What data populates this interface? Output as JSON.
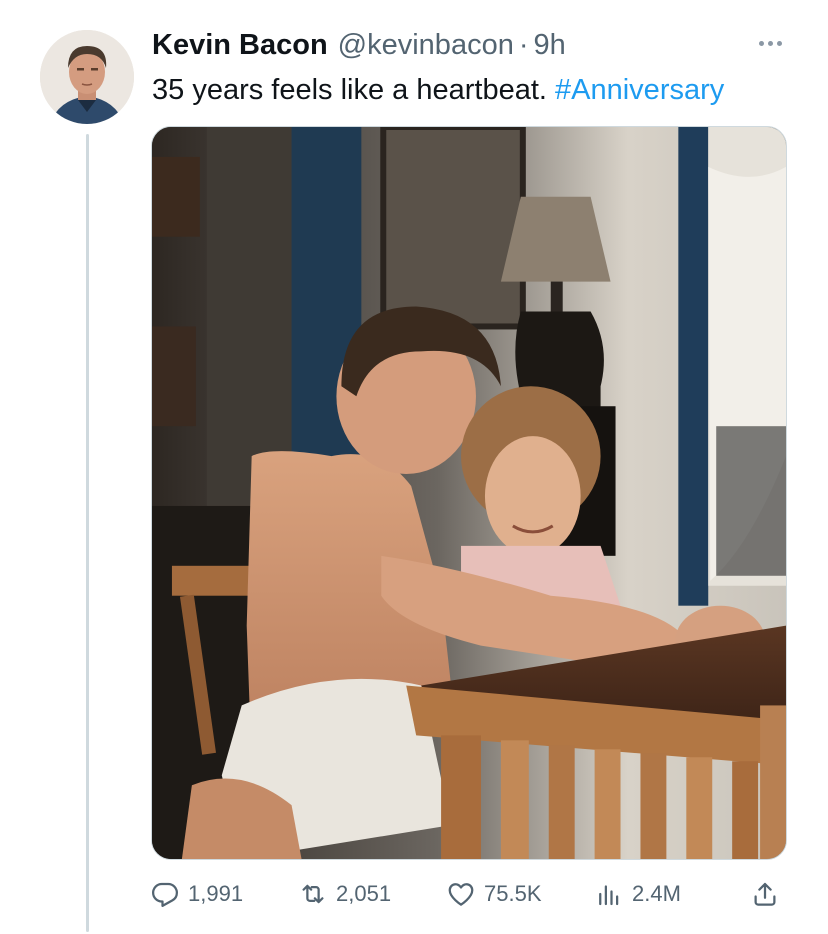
{
  "tweet": {
    "author_name": "Kevin Bacon",
    "handle": "@kevinbacon",
    "separator": "·",
    "time": "9h",
    "text": "35 years feels like a heartbeat. ",
    "hashtag": "#Anniversary",
    "avatar_icon": "avatar-photo",
    "media_description_icon": "photo"
  },
  "actions": {
    "reply_count": "1,991",
    "retweet_count": "2,051",
    "like_count": "75.5K",
    "views_count": "2.4M",
    "icons": [
      "reply-icon",
      "retweet-icon",
      "like-icon",
      "views-icon",
      "share-icon"
    ]
  },
  "colors": {
    "text_primary": "#0f1419",
    "text_secondary": "#536471",
    "link": "#1d9bf0",
    "thread_line": "#cfd9de"
  }
}
